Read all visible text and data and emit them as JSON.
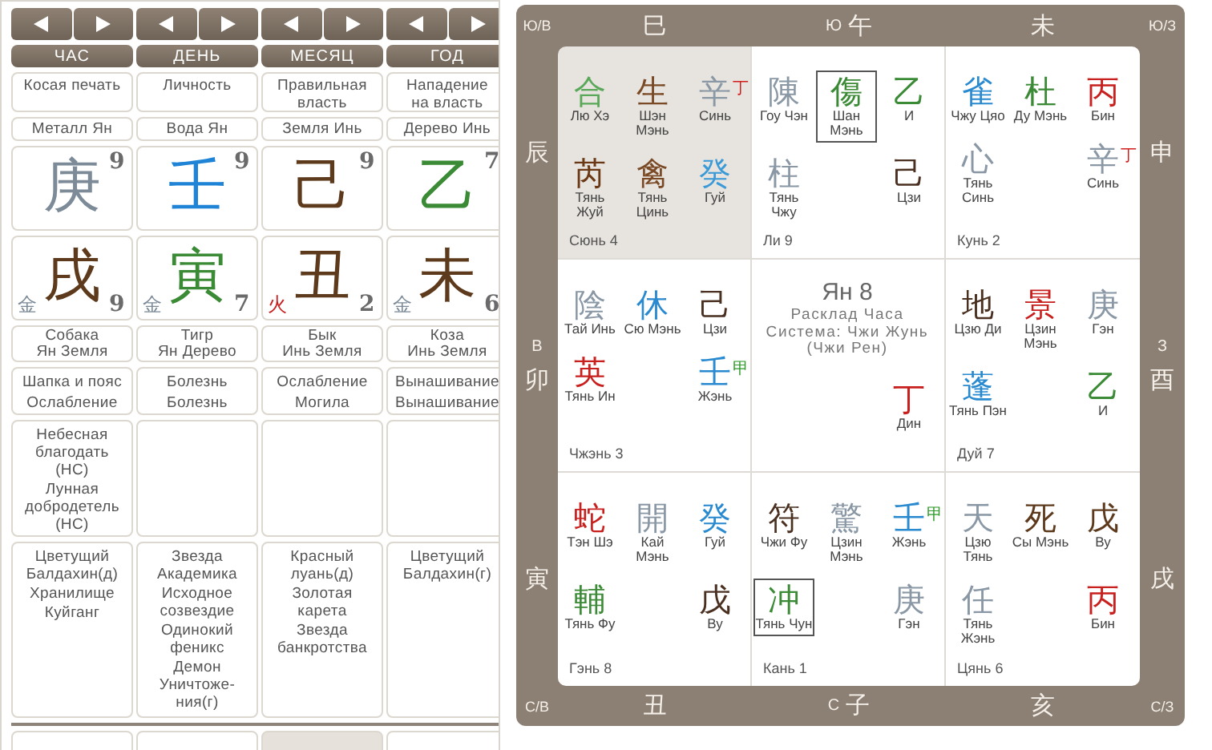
{
  "pillars": [
    {
      "header": "ЧАС",
      "god": "Косая печать",
      "element": "Металл Ян",
      "stem": {
        "char": "庚",
        "color": "#7d8b99",
        "number": "9"
      },
      "branch": {
        "char": "戌",
        "color": "#5e3a1c",
        "number": "9",
        "element": {
          "char": "金",
          "color": "#7d8b99"
        }
      },
      "animal": [
        "Собака",
        "Ян Земля"
      ],
      "phases": [
        "Шапка и пояс",
        "Ослабление"
      ],
      "stars_1": [
        "Небесная благодать (НС)",
        "Лунная добродетель (НС)"
      ],
      "stars_2": [
        "Цветущий Балдахин(д)",
        "Хранилище",
        "Куйганг"
      ]
    },
    {
      "header": "ДЕНЬ",
      "god": "Личность",
      "element": "Вода Ян",
      "stem": {
        "char": "壬",
        "color": "#1f84d6",
        "number": "9"
      },
      "branch": {
        "char": "寅",
        "color": "#3b8a35",
        "number": "7",
        "element": {
          "char": "金",
          "color": "#7d8b99"
        }
      },
      "animal": [
        "Тигр",
        "Ян Дерево"
      ],
      "phases": [
        "Болезнь",
        "Болезнь"
      ],
      "stars_2": [
        "Звезда Академика",
        "Исходное созвездие",
        "Одинокий феникс",
        "Демон Уничтоже-\nния(г)"
      ]
    },
    {
      "header": "МЕСЯЦ",
      "god": "Правильная власть",
      "element": "Земля Инь",
      "stem": {
        "char": "己",
        "color": "#5e3a1c",
        "number": "9"
      },
      "branch": {
        "char": "丑",
        "color": "#5e3a1c",
        "number": "2",
        "element": {
          "char": "火",
          "color": "#c8201e"
        }
      },
      "animal": [
        "Бык",
        "Инь Земля"
      ],
      "phases": [
        "Ослабление",
        "Могила"
      ],
      "stars_2": [
        "Красный луань(д)",
        "Золотая карета",
        "Звезда банкротства"
      ]
    },
    {
      "header": "ГОД",
      "god": "Нападение на власть",
      "element": "Дерево Инь",
      "stem": {
        "char": "乙",
        "color": "#3b8a35",
        "number": "7"
      },
      "branch": {
        "char": "未",
        "color": "#5e3a1c",
        "number": "6",
        "element": {
          "char": "金",
          "color": "#7d8b99"
        }
      },
      "animal": [
        "Коза",
        "Инь Земля"
      ],
      "phases": [
        "Вынашивание",
        "Вынашивание"
      ],
      "stars_2": [
        "Цветущий Балдахин(г)"
      ]
    }
  ],
  "next_row": [
    {
      "selected": false
    },
    {
      "selected": false
    },
    {
      "selected": true
    },
    {
      "selected": false
    }
  ],
  "frame": {
    "corners": [
      "Ю/В",
      "Ю/З",
      "С/В",
      "С/З"
    ],
    "top": [
      {
        "branch": "巳"
      },
      {
        "direction": "Ю",
        "branch": "午"
      },
      {
        "branch": "未"
      }
    ],
    "left": [
      {
        "branch": "辰"
      },
      {
        "direction": "В",
        "branch": "卯"
      },
      {
        "branch": "寅"
      }
    ],
    "right": [
      {
        "branch": "申"
      },
      {
        "direction": "З",
        "branch": "酉"
      },
      {
        "branch": "戌"
      }
    ],
    "bottom": [
      {
        "branch": "丑"
      },
      {
        "direction": "С",
        "branch": "子"
      },
      {
        "branch": "亥"
      }
    ]
  },
  "palaces": [
    {
      "kind": "palace",
      "name": "Сюнь 4",
      "highlighted": true,
      "items": [
        {
          "kind": "star",
          "char": "合",
          "color": "#5aa85a",
          "label": "Лю Хэ",
          "selected": false
        },
        {
          "kind": "star",
          "char": "生",
          "color": "#7a4a26",
          "label": "Шэн Мэнь",
          "selected": false
        },
        {
          "kind": "star",
          "char": "辛",
          "color": "#8a98a6",
          "label": "Синь",
          "selected": false,
          "mark": {
            "char": "丁",
            "color": "#d0201e"
          }
        },
        {
          "kind": "star",
          "char": "芮",
          "color": "#6a3814",
          "label": "Тянь Жуй",
          "selected": false
        },
        {
          "kind": "star",
          "char": "禽",
          "color": "#7a4a26",
          "label": "Тянь Цинь",
          "selected": false
        },
        {
          "kind": "star",
          "char": "癸",
          "color": "#3a9ad8",
          "label": "Гуй",
          "selected": false
        }
      ]
    },
    {
      "kind": "palace",
      "name": "Ли 9",
      "highlighted": false,
      "items": [
        {
          "kind": "star",
          "char": "陳",
          "color": "#8a98a6",
          "label": "Гоу Чэн",
          "selected": false
        },
        {
          "kind": "star",
          "char": "傷",
          "color": "#3b8a35",
          "label": "Шан Мэнь",
          "selected": true
        },
        {
          "kind": "star",
          "char": "乙",
          "color": "#3b8a35",
          "label": "И",
          "selected": false
        },
        {
          "kind": "star",
          "char": "柱",
          "color": "#8a98a6",
          "label": "Тянь Чжу",
          "selected": false
        },
        {
          "kind": "empty"
        },
        {
          "kind": "star",
          "char": "己",
          "color": "#4a3020",
          "label": "Цзи",
          "selected": false
        }
      ]
    },
    {
      "kind": "palace",
      "name": "Кунь 2",
      "highlighted": false,
      "items": [
        {
          "kind": "star",
          "char": "雀",
          "color": "#2a8ad0",
          "label": "Чжу Цяо",
          "selected": false
        },
        {
          "kind": "star",
          "char": "杜",
          "color": "#3b8a35",
          "label": "Ду Мэнь",
          "selected": false
        },
        {
          "kind": "star",
          "char": "丙",
          "color": "#c8201e",
          "label": "Бин",
          "selected": false
        },
        {
          "kind": "star",
          "char": "心",
          "color": "#8a98a6",
          "label": "Тянь Синь",
          "selected": false
        },
        {
          "kind": "empty"
        },
        {
          "kind": "star",
          "char": "辛",
          "color": "#8a98a6",
          "label": "Синь",
          "selected": false,
          "mark": {
            "char": "丁",
            "color": "#d0201e"
          }
        }
      ]
    },
    {
      "kind": "palace",
      "name": "Чжэнь 3",
      "highlighted": false,
      "items": [
        {
          "kind": "star",
          "char": "陰",
          "color": "#8a98a6",
          "label": "Тай Инь",
          "selected": false
        },
        {
          "kind": "star",
          "char": "休",
          "color": "#2a8ad0",
          "label": "Сю Мэнь",
          "selected": false
        },
        {
          "kind": "star",
          "char": "己",
          "color": "#4a3020",
          "label": "Цзи",
          "selected": false
        },
        {
          "kind": "star",
          "char": "英",
          "color": "#c8201e",
          "label": "Тянь Ин",
          "selected": false
        },
        {
          "kind": "empty"
        },
        {
          "kind": "star",
          "char": "壬",
          "color": "#2a8ad0",
          "label": "Жэнь",
          "selected": false,
          "mark": {
            "char": "甲",
            "color": "#2f9a2a"
          }
        }
      ]
    },
    {
      "kind": "center",
      "title": "Ян 8",
      "lines": [
        "Расклад Часа",
        "Система: Чжи Жунь",
        "(Чжи Рен)"
      ],
      "items": [
        {
          "kind": "empty"
        },
        {
          "kind": "empty"
        },
        {
          "kind": "star",
          "char": "丁",
          "color": "#c8201e",
          "label": "Дин",
          "selected": false
        }
      ]
    },
    {
      "kind": "palace",
      "name": "Дуй 7",
      "highlighted": false,
      "items": [
        {
          "kind": "star",
          "char": "地",
          "color": "#4a3020",
          "label": "Цзю Ди",
          "selected": false
        },
        {
          "kind": "star",
          "char": "景",
          "color": "#c8201e",
          "label": "Цзин Мэнь",
          "selected": false
        },
        {
          "kind": "star",
          "char": "庚",
          "color": "#8a98a6",
          "label": "Гэн",
          "selected": false
        },
        {
          "kind": "star",
          "char": "蓬",
          "color": "#2a8ad0",
          "label": "Тянь Пэн",
          "selected": false
        },
        {
          "kind": "empty"
        },
        {
          "kind": "star",
          "char": "乙",
          "color": "#3b8a35",
          "label": "И",
          "selected": false
        }
      ]
    },
    {
      "kind": "palace",
      "name": "Гэнь 8",
      "highlighted": false,
      "items": [
        {
          "kind": "star",
          "char": "蛇",
          "color": "#c8201e",
          "label": "Тэн Шэ",
          "selected": false
        },
        {
          "kind": "star",
          "char": "開",
          "color": "#8a98a6",
          "label": "Кай Мэнь",
          "selected": false
        },
        {
          "kind": "star",
          "char": "癸",
          "color": "#2a8ad0",
          "label": "Гуй",
          "selected": false
        },
        {
          "kind": "star",
          "char": "輔",
          "color": "#3b8a35",
          "label": "Тянь Фу",
          "selected": false
        },
        {
          "kind": "empty"
        },
        {
          "kind": "star",
          "char": "戊",
          "color": "#4a3020",
          "label": "Ву",
          "selected": false
        }
      ]
    },
    {
      "kind": "palace",
      "name": "Кань 1",
      "highlighted": false,
      "items": [
        {
          "kind": "star",
          "char": "符",
          "color": "#4a3020",
          "label": "Чжи Фу",
          "selected": false
        },
        {
          "kind": "star",
          "char": "驚",
          "color": "#8a98a6",
          "label": "Цзин Мэнь",
          "selected": false
        },
        {
          "kind": "star",
          "char": "壬",
          "color": "#2a8ad0",
          "label": "Жэнь",
          "selected": false,
          "mark": {
            "char": "甲",
            "color": "#2f9a2a"
          }
        },
        {
          "kind": "star",
          "char": "冲",
          "color": "#3b8a35",
          "label": "Тянь Чун",
          "selected": true
        },
        {
          "kind": "empty"
        },
        {
          "kind": "star",
          "char": "庚",
          "color": "#8a98a6",
          "label": "Гэн",
          "selected": false
        }
      ]
    },
    {
      "kind": "palace",
      "name": "Цянь 6",
      "highlighted": false,
      "items": [
        {
          "kind": "star",
          "char": "天",
          "color": "#8a98a6",
          "label": "Цзю Тянь",
          "selected": false
        },
        {
          "kind": "star",
          "char": "死",
          "color": "#5e3a1c",
          "label": "Сы Мэнь",
          "selected": false
        },
        {
          "kind": "star",
          "char": "戊",
          "color": "#5e3a1c",
          "label": "Ву",
          "selected": false
        },
        {
          "kind": "star",
          "char": "任",
          "color": "#8a98a6",
          "label": "Тянь Жэнь",
          "selected": false
        },
        {
          "kind": "empty"
        },
        {
          "kind": "star",
          "char": "丙",
          "color": "#c8201e",
          "label": "Бин",
          "selected": false
        }
      ]
    }
  ]
}
